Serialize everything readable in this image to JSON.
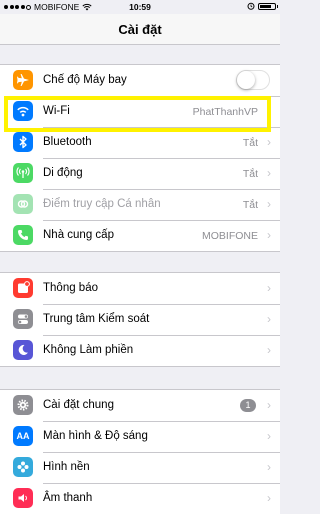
{
  "status_bar": {
    "carrier": "MOBIFONE",
    "time": "10:59",
    "signal_bars": 4
  },
  "nav": {
    "title": "Cài đặt"
  },
  "groups": [
    {
      "rows": [
        {
          "label": "Chế độ Máy bay",
          "icon": "airplane-icon",
          "icon_color": "#ff9500",
          "control": "toggle",
          "toggle_on": false
        },
        {
          "label": "Wi-Fi",
          "icon": "wifi-icon",
          "icon_color": "#007aff",
          "value": "PhatThanhVP",
          "highlighted": true
        },
        {
          "label": "Bluetooth",
          "icon": "bluetooth-icon",
          "icon_color": "#007aff",
          "value": "Tắt"
        },
        {
          "label": "Di động",
          "icon": "cellular-icon",
          "icon_color": "#4cd964",
          "value": "Tắt"
        },
        {
          "label": "Điểm truy cập Cá nhân",
          "icon": "hotspot-icon",
          "icon_color": "#a3e3b3",
          "value": "Tắt",
          "disabled": true
        },
        {
          "label": "Nhà cung cấp",
          "icon": "phone-icon",
          "icon_color": "#4cd964",
          "value": "MOBIFONE"
        }
      ]
    },
    {
      "rows": [
        {
          "label": "Thông báo",
          "icon": "notifications-icon",
          "icon_color": "#ff3b30"
        },
        {
          "label": "Trung tâm Kiểm soát",
          "icon": "control-center-icon",
          "icon_color": "#8e8e93"
        },
        {
          "label": "Không Làm phiền",
          "icon": "moon-icon",
          "icon_color": "#5856d6"
        }
      ]
    },
    {
      "rows": [
        {
          "label": "Cài đặt chung",
          "icon": "gear-icon",
          "icon_color": "#8e8e93",
          "badge": "1"
        },
        {
          "label": "Màn hình & Độ sáng",
          "icon": "display-icon",
          "icon_color": "#007aff",
          "icon_text": "AA"
        },
        {
          "label": "Hình nền",
          "icon": "wallpaper-icon",
          "icon_color": "#34aadc"
        },
        {
          "label": "Âm thanh",
          "icon": "sound-icon",
          "icon_color": "#ff2d55"
        }
      ]
    }
  ],
  "highlight_color": "#fff200"
}
